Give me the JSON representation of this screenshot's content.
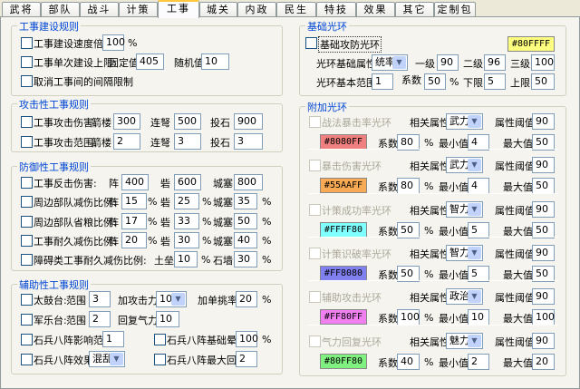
{
  "tabs": [
    "武将",
    "部队",
    "战斗",
    "计策",
    "工事",
    "城关",
    "内政",
    "民生",
    "特技",
    "效果",
    "其它",
    "定制包"
  ],
  "active_tab": "工事",
  "build": {
    "title": "工事建设规则",
    "speed_label": "工事建设速度倍率",
    "speed": "100",
    "pct": "%",
    "limit_label": "工事单次建设上限:",
    "fixed_label": "固定值",
    "fixed": "405",
    "random_label": "随机值",
    "random": "10",
    "cancel_label": "取消工事间的间隔限制"
  },
  "attack": {
    "title": "攻击性工事规则",
    "damage_label": "工事攻击伤害:",
    "range_label": "工事攻击范围:",
    "tower": "箭楼",
    "crossbow": "连弩",
    "catapult": "投石",
    "damage": [
      "300",
      "500",
      "900"
    ],
    "range": [
      "2",
      "3",
      "3"
    ]
  },
  "defense": {
    "title": "防御性工事规则",
    "rows": [
      {
        "label": "工事反击伤害:",
        "l1": "阵",
        "v1": "400",
        "l2": "砦",
        "v2": "600",
        "l3": "城塞",
        "v3": "800",
        "pct": ""
      },
      {
        "label": "周边部队减伤比例:",
        "l1": "阵",
        "v1": "15",
        "l2": "砦",
        "v2": "25",
        "l3": "城塞",
        "v3": "35",
        "pct": "%"
      },
      {
        "label": "周边部队省粮比例:",
        "l1": "阵",
        "v1": "17",
        "l2": "砦",
        "v2": "33",
        "l3": "城塞",
        "v3": "50",
        "pct": "%"
      },
      {
        "label": "工事耐久减伤比例:",
        "l1": "阵",
        "v1": "20",
        "l2": "砦",
        "v2": "30",
        "l3": "城塞",
        "v3": "40",
        "pct": "%"
      }
    ],
    "barrier": {
      "label": "障碍类工事耐久减伤比例:",
      "l1": "土垒",
      "v1": "10",
      "l2": "石墙",
      "v2": "30",
      "pct": "%"
    }
  },
  "support": {
    "title": "辅助性工事规则",
    "drum_label": "太鼓台:",
    "range_label": "范围",
    "drum_range": "3",
    "atk_label": "加攻击力",
    "atk": "10%",
    "single_label": "加单挑率",
    "single": "20",
    "pct": "%",
    "music_label": "军乐台:",
    "music_range": "2",
    "morale_label": "回复气力",
    "morale": "10",
    "stone_range_label": "石兵八阵影响范围",
    "stone_range": "1",
    "stone_base_label": "石兵八阵基础晕率",
    "stone_base": "100",
    "stone_effect_label": "石兵八阵效果",
    "stone_effect": "混乱",
    "stone_max_label": "石兵八阵最大回合",
    "stone_max": "2"
  },
  "base_aura": {
    "title": "基础光环",
    "label": "基础攻防光环",
    "color_text": "#80FFFF",
    "color": "#ffff80",
    "attr_label": "光环基础属性",
    "attr": "统率",
    "lv1_label": "一级",
    "lv1": "90",
    "lv2_label": "二级",
    "lv2": "96",
    "lv3_label": "三级",
    "lv3": "100",
    "range_label": "光环基本范围",
    "range": "1",
    "coef_label": "系数",
    "coef": "50",
    "pct": "%",
    "min_label": "下限",
    "min": "5",
    "max_label": "上限",
    "max": "50"
  },
  "extra_aura": {
    "title": "附加光环",
    "attr_label": "相关属性",
    "thr_label": "属性阈值",
    "coef_label": "系数",
    "pct": "%",
    "min_label": "最小值",
    "max_label": "最大值",
    "items": [
      {
        "label": "战法暴击率光环",
        "attr": "武力",
        "thr": "90",
        "color_text": "#8080FF",
        "color": "#f08080",
        "coef": "80",
        "min": "4",
        "max": "50"
      },
      {
        "label": "暴击伤害光环",
        "attr": "武力",
        "thr": "90",
        "color_text": "#55AAFF",
        "color": "#f8aa55",
        "coef": "80",
        "min": "4",
        "max": "50"
      },
      {
        "label": "计策成功率光环",
        "attr": "智力",
        "thr": "90",
        "color_text": "#FFFF80",
        "color": "#80ffff",
        "coef": "50",
        "min": "5",
        "max": "50"
      },
      {
        "label": "计策识破率光环",
        "attr": "智力",
        "thr": "90",
        "color_text": "#FF8080",
        "color": "#8080f0",
        "coef": "50",
        "min": "5",
        "max": "50"
      },
      {
        "label": "辅助攻击光环",
        "attr": "政治",
        "thr": "90",
        "color_text": "#FF80FF",
        "color": "#f080f0",
        "coef": "100",
        "min": "10",
        "max": "100"
      },
      {
        "label": "气力回复光环",
        "attr": "魅力",
        "thr": "90",
        "color_text": "#80FF80",
        "color": "#80f080",
        "coef": "40",
        "min": "2",
        "max": "20"
      }
    ]
  }
}
